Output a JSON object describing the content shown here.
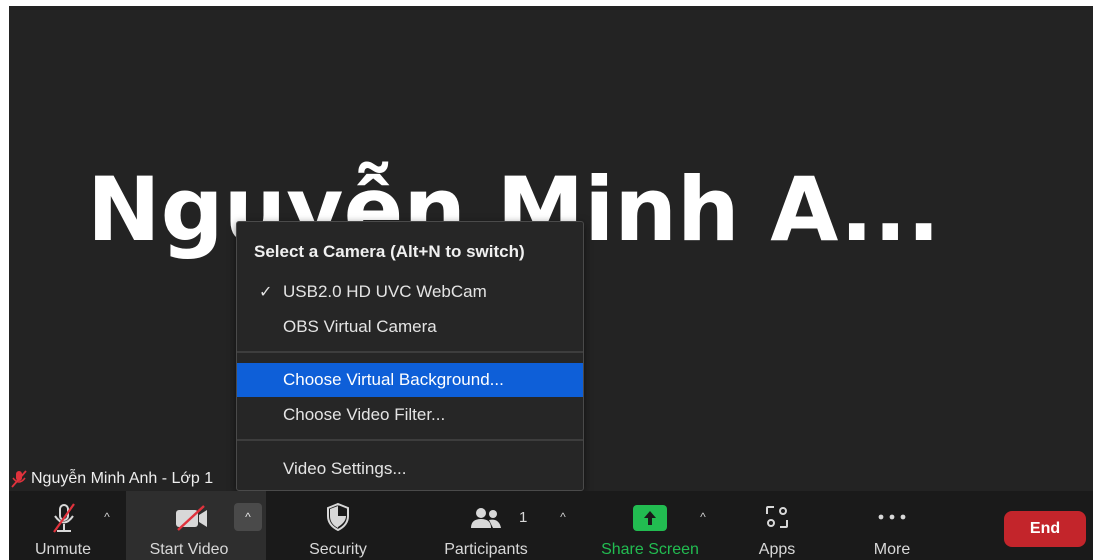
{
  "video": {
    "display_name_large": "Nguyễn Minh A...",
    "participant_label": "Nguyễn Minh Anh - Lớp 1"
  },
  "camera_menu": {
    "heading": "Select a Camera (Alt+N to switch)",
    "cameras": [
      {
        "label": "USB2.0 HD UVC WebCam",
        "selected": true
      },
      {
        "label": "OBS Virtual Camera",
        "selected": false
      }
    ],
    "options": [
      {
        "label": "Choose Virtual Background...",
        "highlighted": true
      },
      {
        "label": "Choose Video Filter...",
        "highlighted": false
      }
    ],
    "settings_label": "Video Settings...",
    "check_glyph": "✓"
  },
  "toolbar": {
    "unmute_label": "Unmute",
    "start_video_label": "Start Video",
    "security_label": "Security",
    "participants_label": "Participants",
    "participants_count": "1",
    "share_screen_label": "Share Screen",
    "apps_label": "Apps",
    "more_label": "More",
    "end_label": "End",
    "caret_glyph": "^"
  },
  "colors": {
    "background": "#232323",
    "toolbar": "#1a1a1a",
    "menu_highlight": "#0e5fd8",
    "share_green": "#22bc51",
    "end_red": "#c3252b",
    "muted_red": "#e0323c"
  }
}
